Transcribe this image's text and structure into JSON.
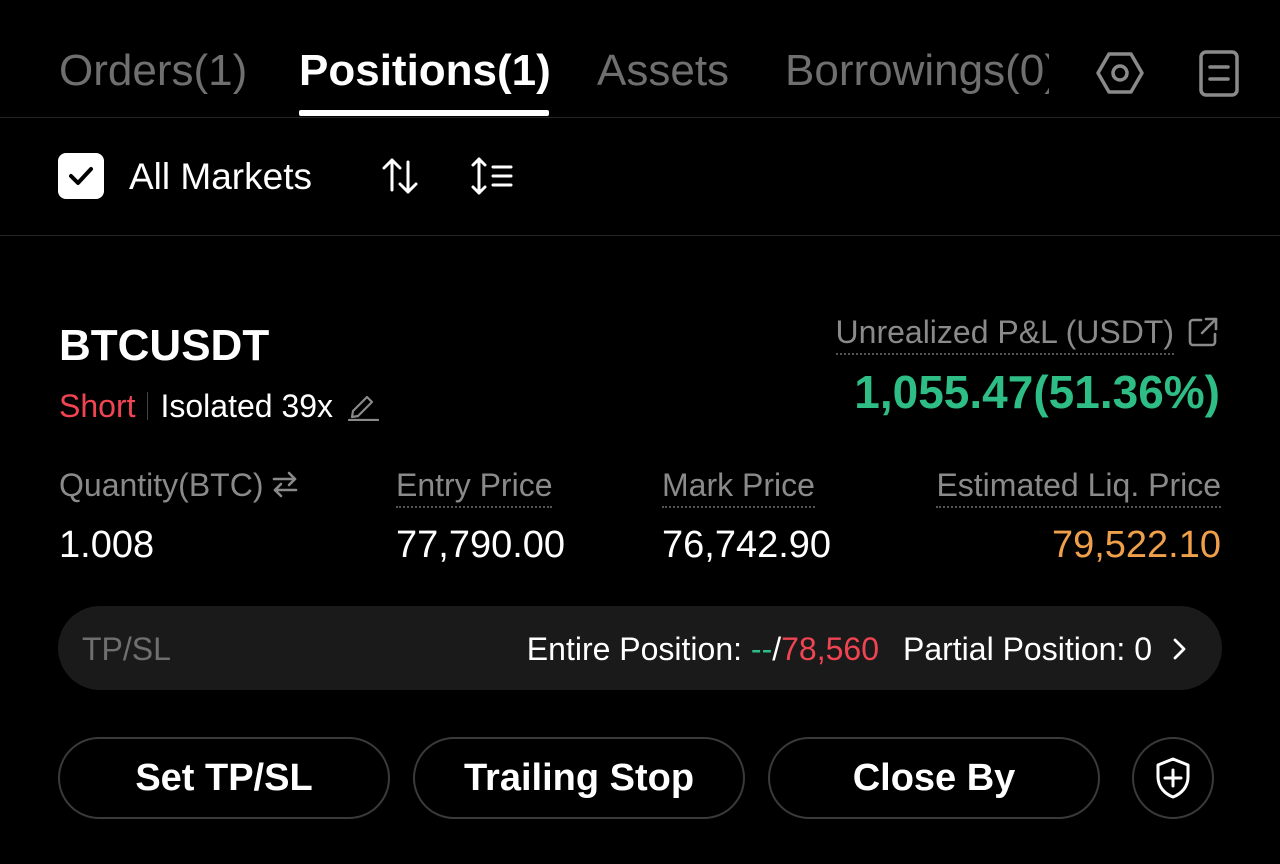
{
  "tabs": [
    {
      "label": "Orders(1)",
      "active": false
    },
    {
      "label": "Positions(1)",
      "active": true
    },
    {
      "label": "Assets",
      "active": false
    },
    {
      "label": "Borrowings(0)",
      "active": false
    }
  ],
  "tab_icons": [
    "settings-hex-icon",
    "clipboard-icon"
  ],
  "filter": {
    "all_markets_label": "All Markets",
    "all_markets_checked": true,
    "icons": [
      "sort-arrows-icon",
      "list-sort-icon"
    ]
  },
  "position": {
    "symbol": "BTCUSDT",
    "side": "Short",
    "margin_mode": "Isolated 39x",
    "pnl_label": "Unrealized P&L (USDT)",
    "pnl_value": "1,055.47(51.36%)",
    "quantity_label": "Quantity(BTC)",
    "quantity_value": "1.008",
    "entry_label": "Entry Price",
    "entry_value": "77,790.00",
    "mark_label": "Mark Price",
    "mark_value": "76,742.90",
    "liq_label": "Estimated Liq. Price",
    "liq_value": "79,522.10"
  },
  "tpsl": {
    "label": "TP/SL",
    "entire_label": "Entire Position: ",
    "tp_value": "--",
    "separator": "/",
    "sl_value": "78,560",
    "partial_label": "Partial Position: 0"
  },
  "actions": {
    "set_tpsl": "Set TP/SL",
    "trailing_stop": "Trailing Stop",
    "close_by": "Close By",
    "shield_icon": "shield-plus-icon"
  },
  "colors": {
    "profit": "#2ebd85",
    "loss": "#f04452",
    "liq": "#f0a04b",
    "muted": "#8a8a8a"
  }
}
